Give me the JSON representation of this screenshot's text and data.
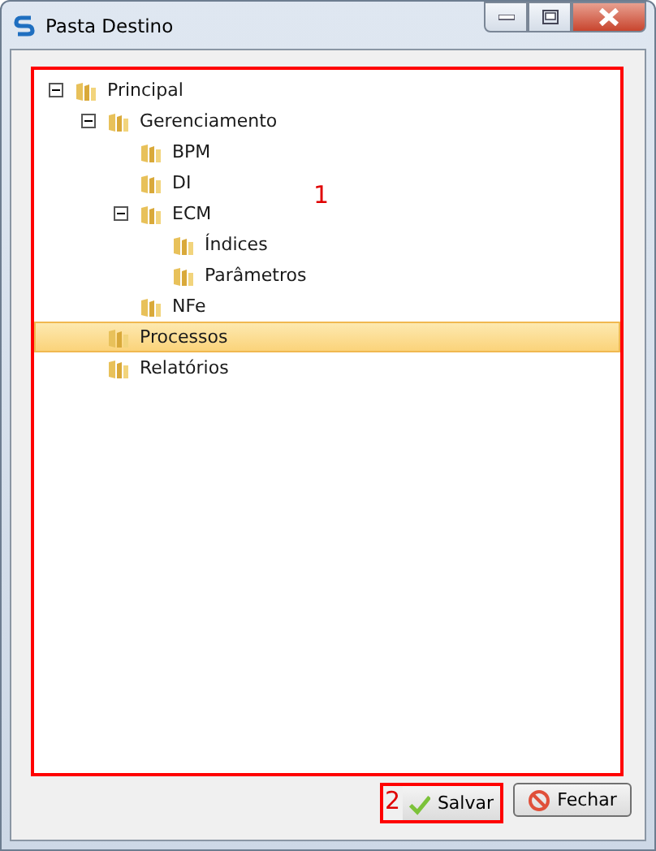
{
  "window": {
    "title": "Pasta Destino"
  },
  "tree": {
    "annotation": "1",
    "items": [
      {
        "label": "Principal",
        "expanded": true,
        "selected": false,
        "children": [
          {
            "label": "Gerenciamento",
            "expanded": true,
            "selected": false,
            "children": [
              {
                "label": "BPM",
                "selected": false
              },
              {
                "label": "DI",
                "selected": false
              },
              {
                "label": "ECM",
                "expanded": true,
                "selected": false,
                "children": [
                  {
                    "label": "Índices",
                    "selected": false
                  },
                  {
                    "label": "Parâmetros",
                    "selected": false
                  }
                ]
              },
              {
                "label": "NFe",
                "selected": false
              }
            ]
          },
          {
            "label": "Processos",
            "selected": true
          },
          {
            "label": "Relatórios",
            "selected": false
          }
        ]
      }
    ]
  },
  "buttons": [
    {
      "kind": "save",
      "label": "Salvar",
      "annotation": "2"
    },
    {
      "kind": "close",
      "label": "Fechar"
    }
  ]
}
